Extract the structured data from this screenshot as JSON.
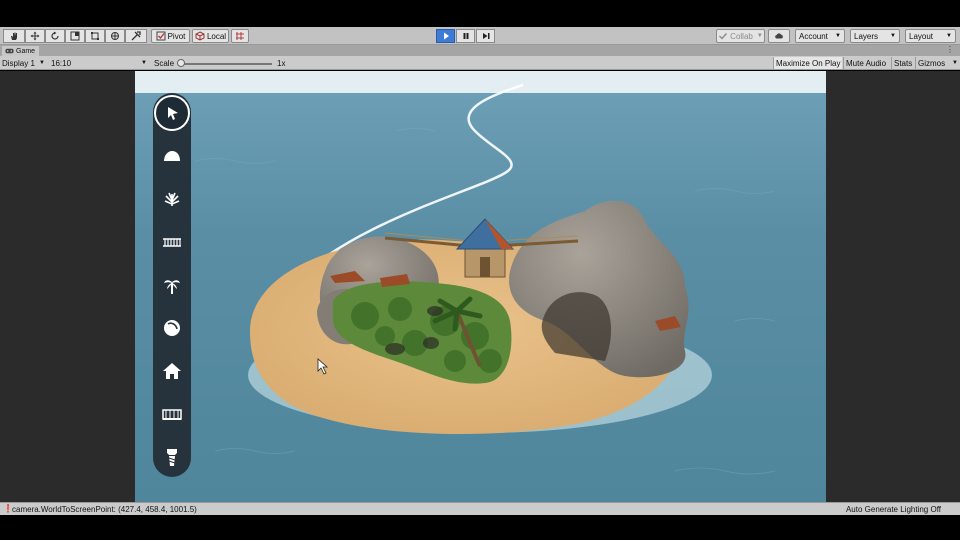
{
  "toolbar": {
    "tools": [
      {
        "icon": "hand-icon"
      },
      {
        "icon": "move-icon"
      },
      {
        "icon": "rotate-icon"
      },
      {
        "icon": "scale-icon"
      },
      {
        "icon": "rect-transform-icon"
      },
      {
        "icon": "transform-icon"
      },
      {
        "icon": "custom-tool-icon"
      }
    ],
    "pivot_label": "Pivot",
    "local_label": "Local",
    "collab_label": "Collab",
    "account_label": "Account",
    "layers_label": "Layers",
    "layout_label": "Layout"
  },
  "tab": {
    "title": "Game"
  },
  "game_bar": {
    "display": "Display 1",
    "aspect": "16:10",
    "scale_label": "Scale",
    "scale_value": "1x",
    "toggles": {
      "maximize": "Maximize On Play",
      "mute": "Mute Audio",
      "stats": "Stats",
      "gizmos": "Gizmos"
    }
  },
  "palette": {
    "items": [
      {
        "icon": "cursor-icon",
        "active": true
      },
      {
        "icon": "rock-icon",
        "active": false
      },
      {
        "icon": "bush-icon",
        "active": false
      },
      {
        "icon": "bridge-icon",
        "active": false
      },
      {
        "icon": "palm-tree-icon",
        "active": false
      },
      {
        "icon": "boulder-icon",
        "active": false
      },
      {
        "icon": "house-icon",
        "active": false
      },
      {
        "icon": "fence-icon",
        "active": false
      },
      {
        "icon": "tower-icon",
        "active": false
      }
    ]
  },
  "status": {
    "message": "camera.WorldToScreenPoint: (427.4, 458.4, 1001.5)",
    "right": "Auto Generate Lighting Off"
  },
  "colors": {
    "play_active": "#3d7bd6",
    "palette_bg": "#26323c",
    "sea": "#5a8ea4",
    "sand": "#e6be86"
  }
}
